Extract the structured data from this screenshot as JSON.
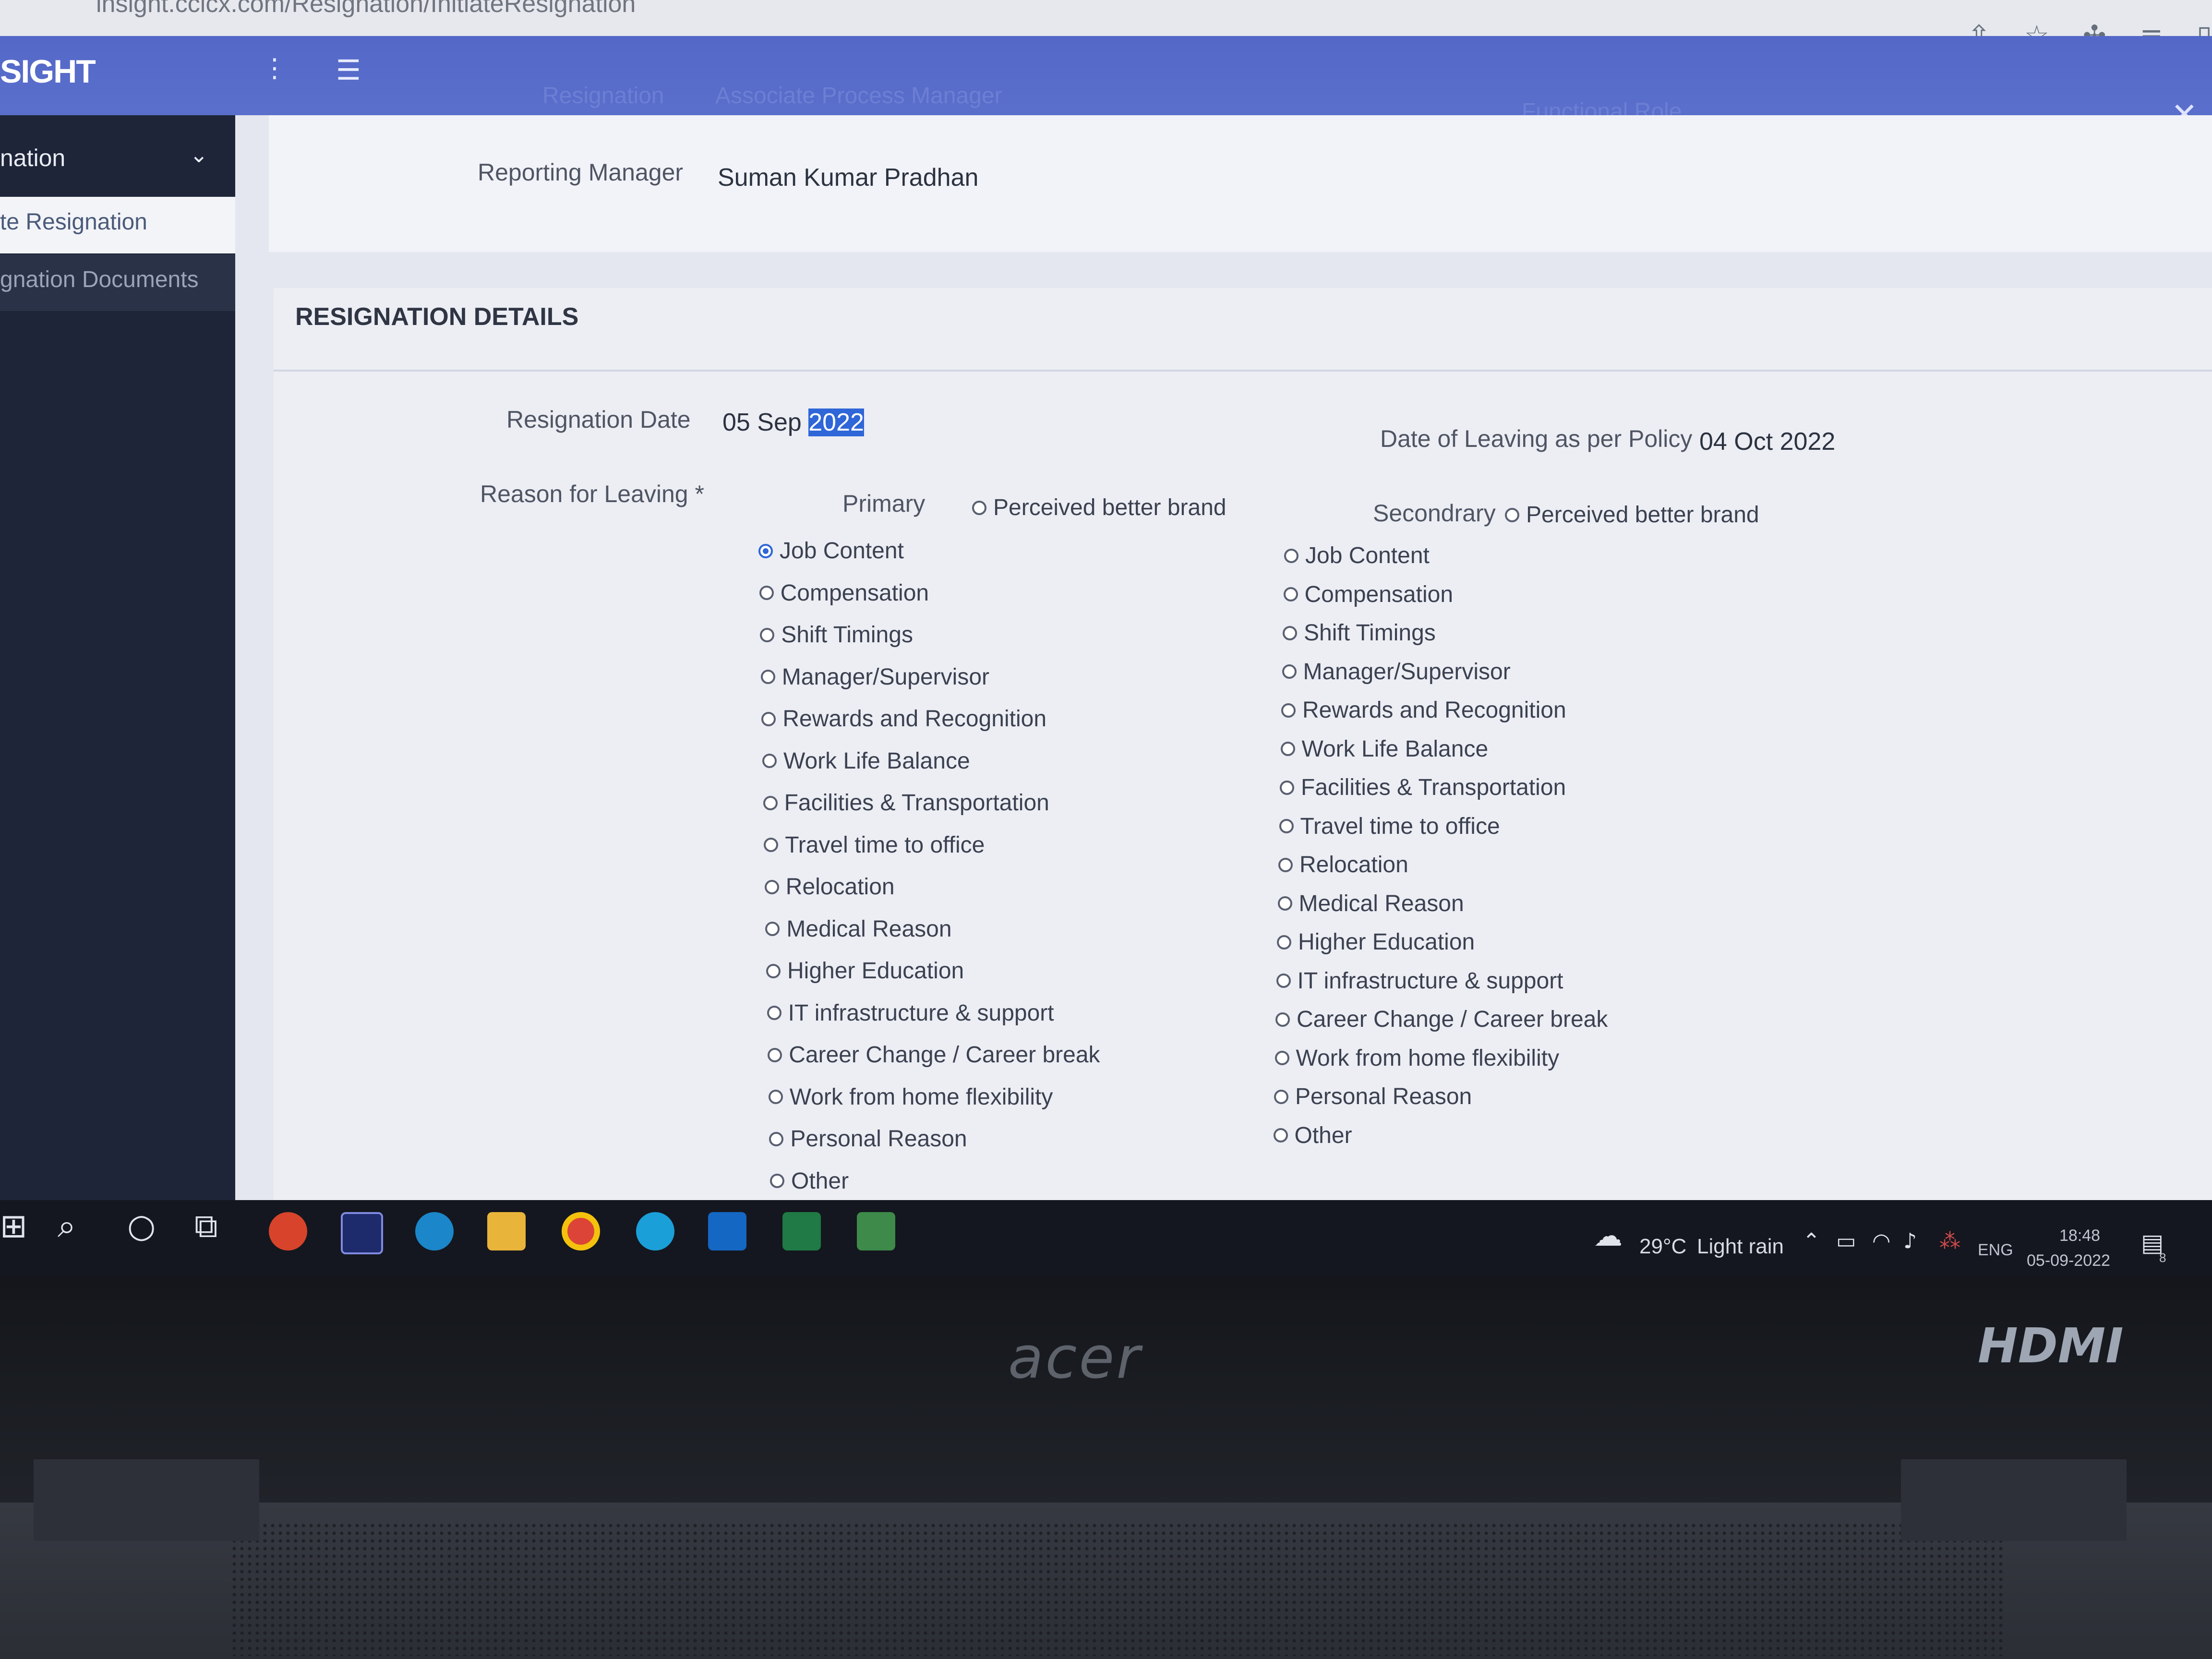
{
  "browser": {
    "url": "insight.ccicx.com/Resignation/InitiateResignation",
    "icons": [
      "share-icon",
      "star-icon",
      "extensions-icon",
      "reading-list-icon"
    ]
  },
  "header": {
    "brand": "SIGHT",
    "breadcrumbs": [
      "Resignation",
      "Associate Process Manager",
      "Functional Role"
    ]
  },
  "sidebar": {
    "group": "nation",
    "items": [
      {
        "label": "te Resignation",
        "active": true
      },
      {
        "label": "gnation Documents",
        "active": false
      }
    ]
  },
  "manager": {
    "label": "Reporting Manager",
    "value": "Suman Kumar Pradhan"
  },
  "details": {
    "title": "RESIGNATION DETAILS",
    "resignation_date_label": "Resignation Date",
    "resignation_date_prefix": "05 Sep ",
    "resignation_date_selected": "2022",
    "leaving_label": "Date of Leaving as per Policy",
    "leaving_value": "04 Oct 2022",
    "reason_label": "Reason for Leaving *"
  },
  "reasons": {
    "primary_label": "Primary",
    "secondary_label": "Secondrary",
    "header_option": "Perceived better brand",
    "options": [
      "Job Content",
      "Compensation",
      "Shift Timings",
      "Manager/Supervisor",
      "Rewards and Recognition",
      "Work Life Balance",
      "Facilities & Transportation",
      "Travel time to office",
      "Relocation",
      "Medical Reason",
      "Higher Education",
      "IT infrastructure & support",
      "Career Change / Career break",
      "Work from home flexibility",
      "Personal Reason",
      "Other"
    ],
    "primary_selected": "Job Content",
    "secondary_selected": ""
  },
  "taskbar": {
    "weather_temp": "29°C",
    "weather_desc": "Light rain",
    "language": "ENG",
    "time": "18:48",
    "date": "05-09-2022",
    "notification_count": "8"
  },
  "laptop": {
    "brand": "acer",
    "port_label": "HDMI"
  },
  "colors": {
    "header": "#5468c8",
    "sidebar": "#1e2538",
    "radio_selected": "#2f66d8",
    "selection_highlight": "#2f66d8"
  }
}
